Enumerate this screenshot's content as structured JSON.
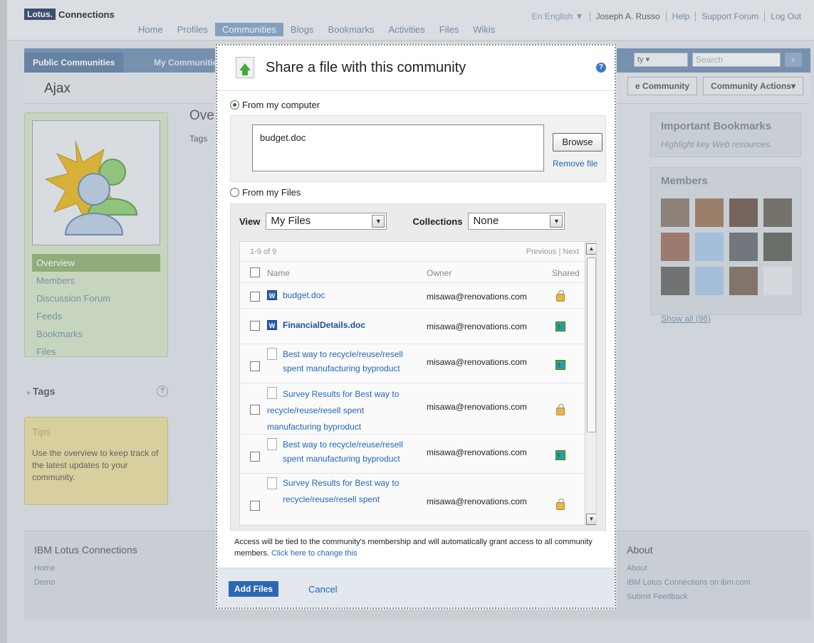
{
  "masthead": {
    "brand_box": "Lotus.",
    "brand_text": "Connections",
    "nav": [
      "Home",
      "Profiles",
      "Communities",
      "Blogs",
      "Bookmarks",
      "Activities",
      "Files",
      "Wikis"
    ],
    "active_nav": "Communities",
    "language": "En English ▼",
    "user": "Joseph A. Russo",
    "help": "Help",
    "support": "Support Forum",
    "logout": "Log Out"
  },
  "tabs": {
    "public": "Public Communities",
    "my": "My Communitie",
    "scope_fragment": "ty",
    "search_placeholder": "Search"
  },
  "community": {
    "name": "Ajax",
    "join_fragment": "e Community",
    "actions": "Community Actions"
  },
  "left_nav": [
    "Overview",
    "Members",
    "Discussion Forum",
    "Feeds",
    "Bookmarks",
    "Files"
  ],
  "tags_label": "Tags",
  "tips": {
    "title": "Tips",
    "text": "Use the overview to keep track of the latest updates to your community."
  },
  "center": {
    "heading_fragment": "Ove",
    "tags_fragment": "Tags"
  },
  "right": {
    "bookmarks_title": "Important Bookmarks",
    "bookmarks_desc": "Highlight key Web resources.",
    "members_title": "Members",
    "show_all": "Show all (96)"
  },
  "footer": {
    "left_title": "IBM Lotus Connections",
    "left_links": [
      "Home",
      "Demo"
    ],
    "right_title": "About",
    "right_links": [
      "About",
      "IBM Lotus Connections on ibm.com",
      "Submit Feedback"
    ]
  },
  "dialog": {
    "title": "Share a file with this community",
    "from_computer": "From my computer",
    "selected_file": "budget.doc",
    "browse": "Browse",
    "remove_file": "Remove file",
    "from_files": "From my Files",
    "view_label": "View",
    "view_value": "My Files",
    "collections_label": "Collections",
    "collections_value": "None",
    "count": "1-9 of 9",
    "pager": "Previous | Next",
    "col_name": "Name",
    "col_owner": "Owner",
    "col_shared": "Shared",
    "files": [
      {
        "name": "budget.doc",
        "owner": "misawa@renovations.com",
        "shared": "lock"
      },
      {
        "name": "FinancialDetails.doc",
        "owner": "misawa@renovations.com",
        "shared": "shared"
      },
      {
        "name": "Best way to recycle/reuse/resell spent manufacturing byproduct",
        "owner": "misawa@renovations.com",
        "shared": "shared"
      },
      {
        "name": "Survey Results for Best way to recycle/reuse/resell spent manufacturing byproduct",
        "owner": "misawa@renovations.com",
        "shared": "lock"
      },
      {
        "name": "Best way to recycle/reuse/resell spent manufacturing byproduct",
        "owner": "misawa@renovations.com",
        "shared": "shared"
      },
      {
        "name": "Survey Results for Best way to recycle/reuse/resell spent",
        "owner": "misawa@renovations.com",
        "shared": "lock"
      }
    ],
    "access_note": "Access will be tied to the community's membership and will automatically grant access to all community members.",
    "access_link": "Click here to change this",
    "add_files": "Add Files",
    "cancel": "Cancel"
  },
  "colors": {
    "accent": "#2c67b4",
    "link": "#2266bb",
    "active_nav": "#8fb06f"
  }
}
